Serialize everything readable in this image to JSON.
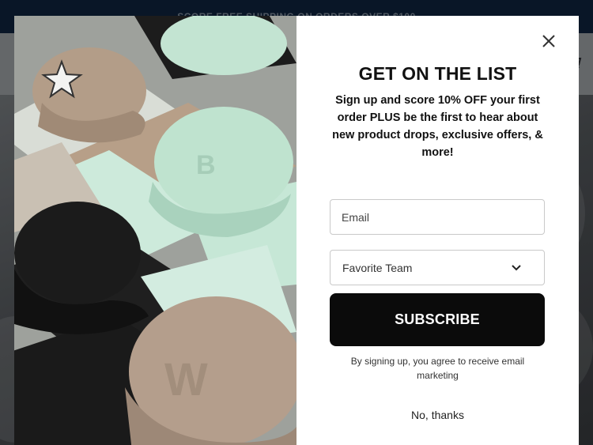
{
  "background": {
    "announcement": "SCORE FREE SHIPPING ON ORDERS OVER $100",
    "cart_icon": "cart-icon"
  },
  "modal": {
    "image_alt": "product-photo-caps",
    "title": "GET ON THE LIST",
    "subtitle": "Sign up and score 10% OFF your first order PLUS be the first to hear about new product drops, exclusive offers, & more!",
    "email": {
      "placeholder": "Email",
      "value": ""
    },
    "team_select": {
      "selected": "Favorite Team",
      "icon": "chevron-down-icon"
    },
    "subscribe_label": "SUBSCRIBE",
    "disclaimer": "By signing up, you agree to receive email marketing",
    "dismiss_label": "No, thanks",
    "close_icon": "close-icon"
  },
  "colors": {
    "announce_bg": "#0b1b2e",
    "button_bg": "#0b0b0b",
    "cap_mint": "#bfe3cf",
    "cap_tan": "#b49e8c"
  }
}
